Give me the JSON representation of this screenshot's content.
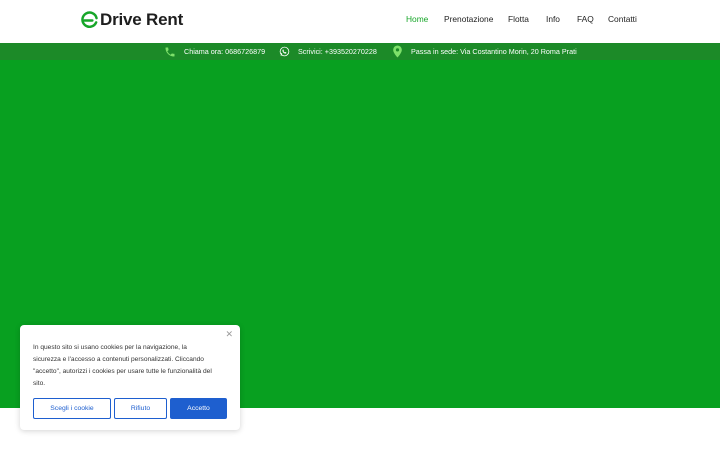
{
  "brand": {
    "logo_text": "Drive Rent",
    "accent": "#17a629"
  },
  "nav": {
    "items": [
      {
        "label": "Home",
        "active": true
      },
      {
        "label": "Prenotazione",
        "active": false
      },
      {
        "label": "Flotta",
        "active": false
      },
      {
        "label": "Info",
        "active": false
      },
      {
        "label": "FAQ",
        "active": false
      },
      {
        "label": "Contatti",
        "active": false
      }
    ]
  },
  "infobar": {
    "color": "#1c8a28",
    "phone": {
      "icon": "phone-icon",
      "text": "Chiama ora: 0686726879"
    },
    "whatsapp": {
      "icon": "whatsapp-icon",
      "text": "Scrivici: +393520270228"
    },
    "address": {
      "icon": "map-pin-icon",
      "text": "Passa in sede: Via Costantino Morin, 20 Roma Prati"
    }
  },
  "hero": {
    "color": "#08a020"
  },
  "cookie_banner": {
    "close_icon": "close-icon",
    "lines": [
      "In questo sito si usano cookies per la navigazione, la",
      "sicurezza e l'accesso a contenuti personalizzati. Cliccando",
      "\"accetto\", autorizzi i cookies per usare tutte le funzionalità del",
      "sito."
    ],
    "choose_label": "Scegli i cookie",
    "reject_label": "Rifiuto",
    "accept_label": "Accetto",
    "button_color": "#1e5fcf"
  }
}
